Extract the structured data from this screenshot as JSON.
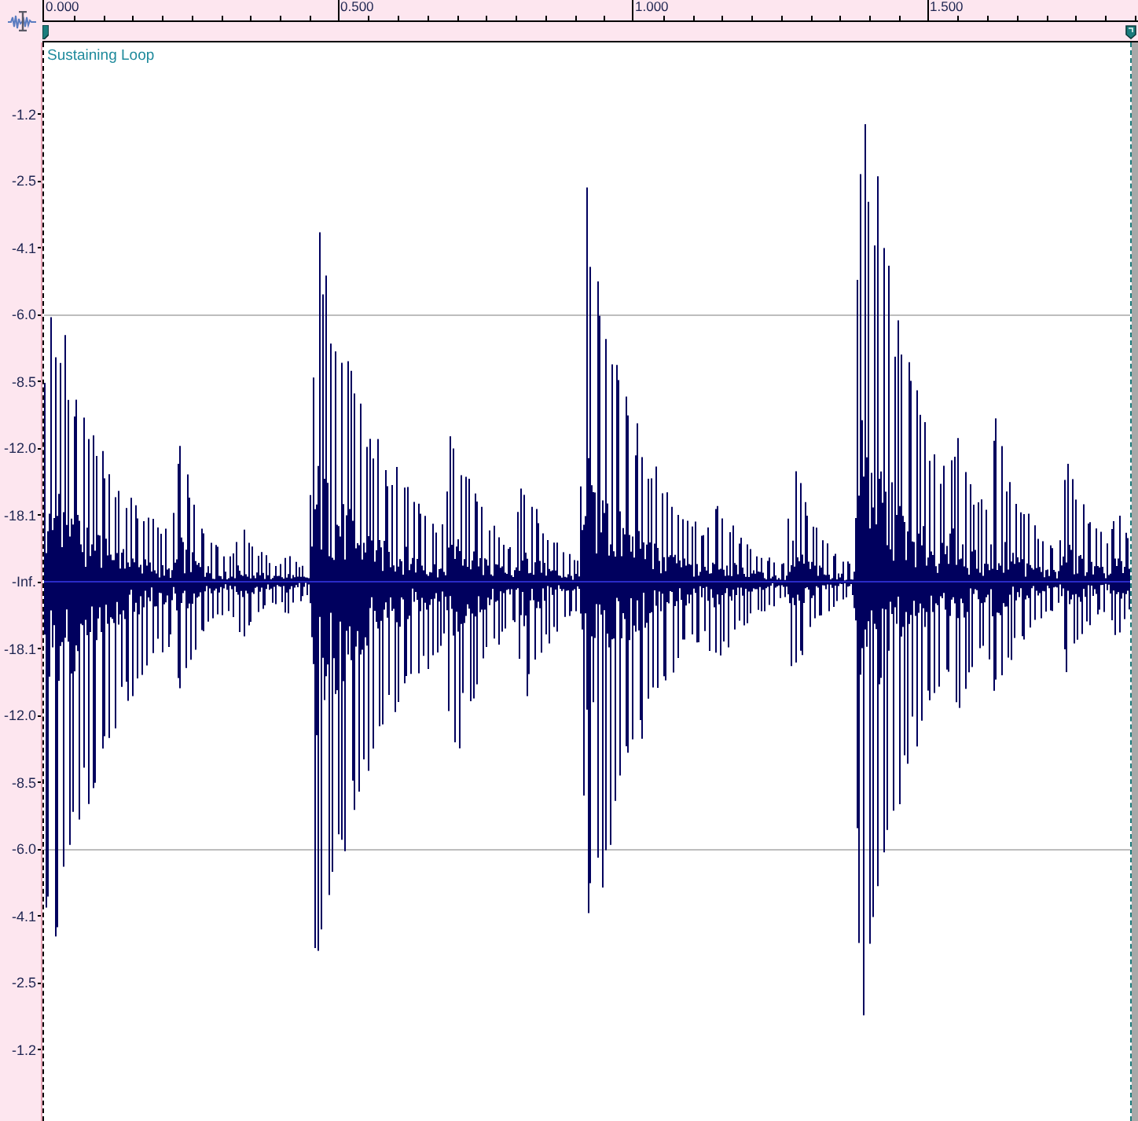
{
  "time_ruler": {
    "labels": [
      "0.000",
      "0.500",
      "1.000",
      "1.500"
    ]
  },
  "track": {
    "title": "Sustaining Loop"
  },
  "level_ruler": {
    "labels": [
      "-1.2",
      "-2.5",
      "-4.1",
      "-6.0",
      "-8.5",
      "-12.0",
      "-18.1",
      "-Inf.",
      "-18.1",
      "-12.0",
      "-8.5",
      "-6.0",
      "-4.1",
      "-2.5",
      "-1.2"
    ]
  }
}
